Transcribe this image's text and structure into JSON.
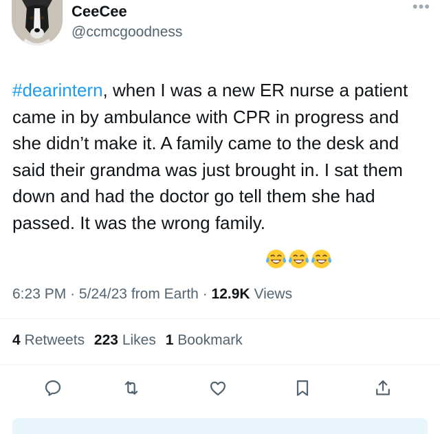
{
  "author": {
    "name": "CeeCee",
    "handle": "@ccmcgoodness"
  },
  "tweet": {
    "hashtag": "#dearintern",
    "text": ", when I was a new ER nurse a patient came in by ambulance with CPR in progress and she didn’t make it. A family came to the desk and said their grandma was just brought in. I sat them down and had the doctor go tell them she had passed. It was the wrong family.",
    "emojis": [
      "😂",
      "😂",
      "😂"
    ]
  },
  "meta": {
    "time": "6:23 PM",
    "date": "5/24/23",
    "source": "from Earth",
    "views_count": "12.9K",
    "views_label": "Views"
  },
  "stats": {
    "retweets_count": "4",
    "retweets_label": "Retweets",
    "likes_count": "223",
    "likes_label": "Likes",
    "bookmarks_count": "1",
    "bookmarks_label": "Bookmark"
  },
  "actions": [
    "reply-icon",
    "retweet-icon",
    "like-icon",
    "bookmark-icon",
    "share-icon"
  ],
  "colors": {
    "link": "#1d9bf0",
    "secondary_text": "#536471",
    "primary_text": "#0f1419"
  }
}
